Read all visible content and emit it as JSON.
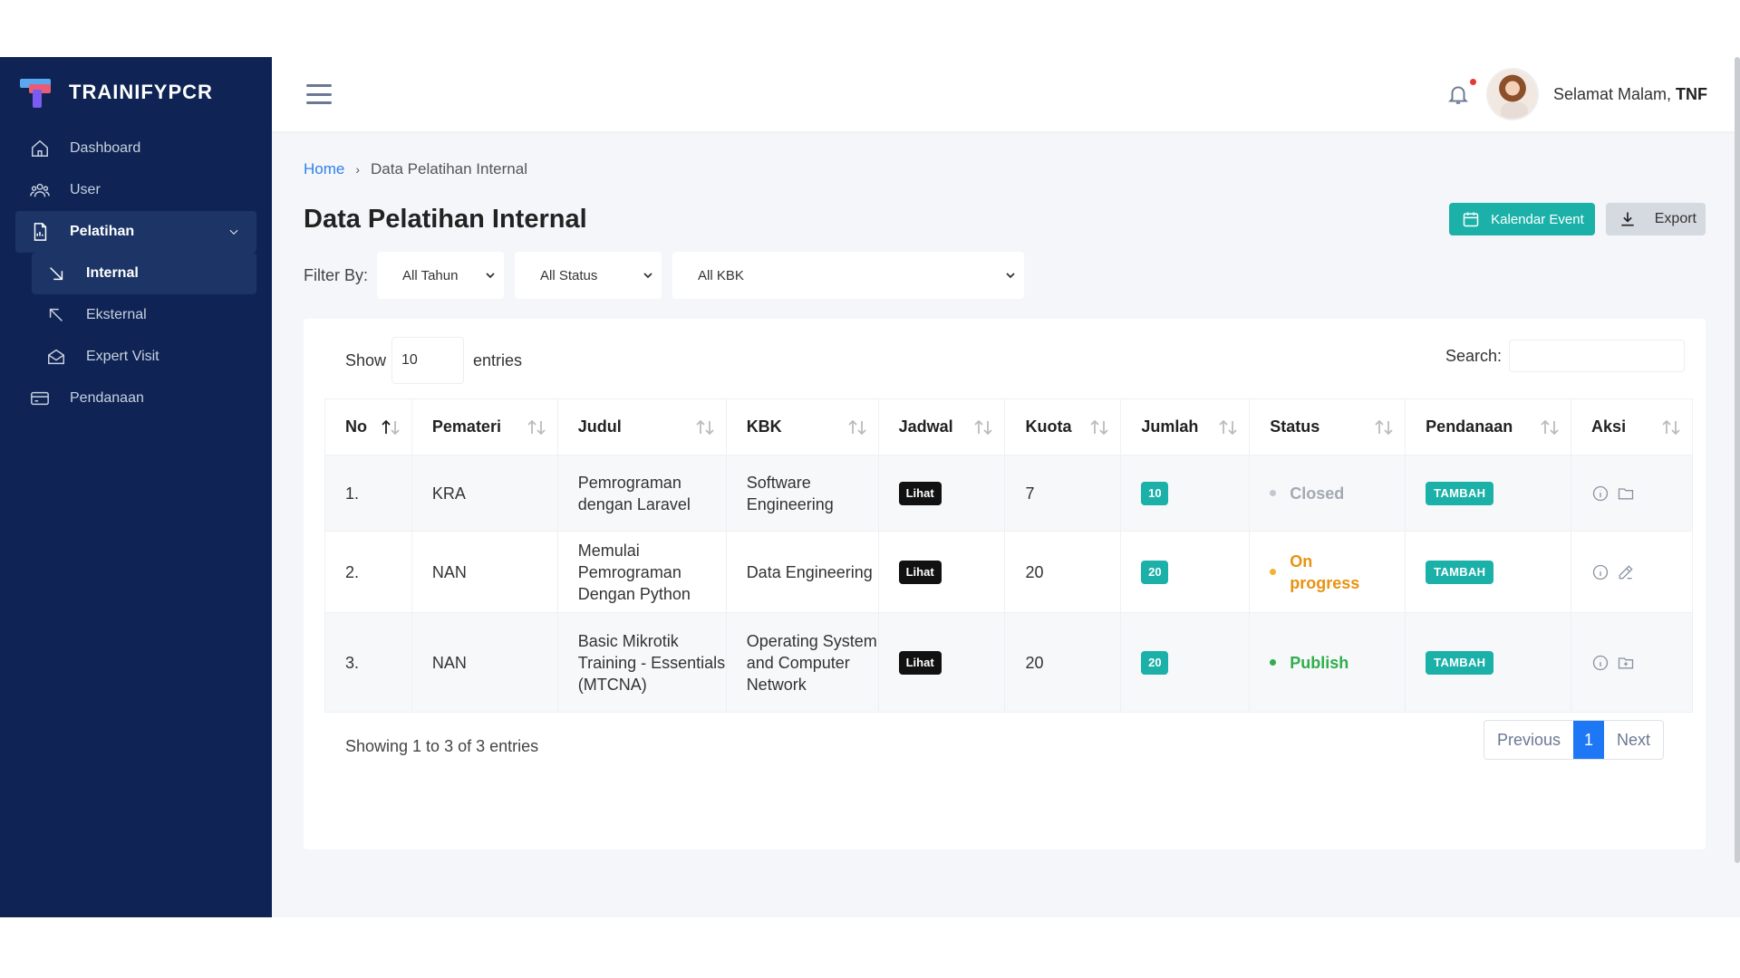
{
  "brand": {
    "name": "TRAINIFYPCR"
  },
  "sidebar": {
    "items": [
      {
        "label": "Dashboard",
        "icon": "home-icon"
      },
      {
        "label": "User",
        "icon": "users-icon"
      },
      {
        "label": "Pelatihan",
        "icon": "document-icon"
      },
      {
        "label": "Internal",
        "icon": "arrow-down-right-icon"
      },
      {
        "label": "Eksternal",
        "icon": "arrow-up-left-icon"
      },
      {
        "label": "Expert Visit",
        "icon": "mail-open-icon"
      },
      {
        "label": "Pendanaan",
        "icon": "card-icon"
      }
    ]
  },
  "header": {
    "greeting": "Selamat Malam, ",
    "user": "TNF"
  },
  "breadcrumb": {
    "home": "Home",
    "sep": "›",
    "current": "Data Pelatihan Internal"
  },
  "page": {
    "title": "Data Pelatihan Internal",
    "calendar_button": "Kalendar Event",
    "export_button": "Export"
  },
  "filter": {
    "label": "Filter By:",
    "tahun": "All Tahun",
    "status": "All Status",
    "kbk": "All KBK"
  },
  "table_controls": {
    "show": "Show",
    "length": "10",
    "entries": "entries",
    "search_label": "Search:"
  },
  "table": {
    "headers": [
      "No",
      "Pemateri",
      "Judul",
      "KBK",
      "Jadwal",
      "Kuota",
      "Jumlah",
      "Status",
      "Pendanaan",
      "Aksi"
    ],
    "rows": [
      {
        "no": "1.",
        "pemateri": "KRA",
        "judul": "Pemrograman dengan Laravel",
        "kbk": "Software Engineering",
        "jadwal": "Lihat",
        "kuota": "7",
        "jumlah": "10",
        "status": "Closed",
        "pendanaan": "TAMBAH"
      },
      {
        "no": "2.",
        "pemateri": "NAN",
        "judul": "Memulai Pemrograman Dengan Python",
        "kbk": "Data Engineering",
        "jadwal": "Lihat",
        "kuota": "20",
        "jumlah": "20",
        "status": "On progress",
        "pendanaan": "TAMBAH"
      },
      {
        "no": "3.",
        "pemateri": "NAN",
        "judul": "Basic Mikrotik Training - Essentials (MTCNA)",
        "kbk": "Operating System and Computer Network",
        "jadwal": "Lihat",
        "kuota": "20",
        "jumlah": "20",
        "status": "Publish",
        "pendanaan": "TAMBAH"
      }
    ]
  },
  "footer": {
    "info": "Showing 1 to 3 of 3 entries",
    "previous": "Previous",
    "page": "1",
    "next": "Next"
  },
  "colors": {
    "sidebar": "#0f2454",
    "accent": "#1bb1a9",
    "primary": "#1e78f5"
  }
}
